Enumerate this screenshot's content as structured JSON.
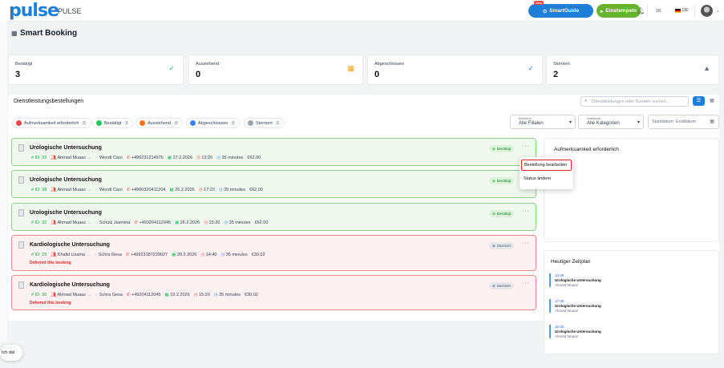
{
  "header": {
    "logo": "pulse",
    "brand": "PULSE",
    "new_badge": "New",
    "smartguide": "SmartGuide",
    "login": "Einstempeln",
    "lang": "DE"
  },
  "page": {
    "title": "Smart Booking"
  },
  "stats": [
    {
      "label": "Bestätigt",
      "value": "3",
      "icon": "✓",
      "color": "#22c55e"
    },
    {
      "label": "Ausstehend",
      "value": "0",
      "icon": "▦",
      "color": "#f59e0b"
    },
    {
      "label": "Abgeschlossen",
      "value": "0",
      "icon": "✓",
      "color": "#3b82f6"
    },
    {
      "label": "Storniert",
      "value": "2",
      "icon": "▲",
      "color": "#6b7280"
    }
  ],
  "section": {
    "title": "Dienstleistungsbestellungen",
    "search_placeholder": "Dienstleistungen oder Kunden suchen..."
  },
  "chips": [
    {
      "label": "Aufmerksamkeit erforderlich",
      "count": "0",
      "color": "#ef4444"
    },
    {
      "label": "Bestätigt",
      "count": "3",
      "color": "#22c55e"
    },
    {
      "label": "Ausstehend",
      "count": "0",
      "color": "#f97316"
    },
    {
      "label": "Abgeschlossen",
      "count": "0",
      "color": "#3b82f6"
    },
    {
      "label": "Storniert",
      "count": "2",
      "color": "#9ca3af"
    }
  ],
  "filters": {
    "branch_label": "Bereiche",
    "branch_value": "Alle Filialen",
    "category_label": "Kategorie",
    "category_value": "Alle Kategorien",
    "date_label": "Startdatum",
    "date_placeholder": "Enddatum"
  },
  "bookings": [
    {
      "title": "Urologische Untersuchung",
      "id": "ID: 33",
      "doctor": "Ahmad Muaaz",
      "patient": "Wendl Caro",
      "phone": "+496231214976",
      "date": "27.2.2026",
      "time": "13:20",
      "duration": "35 minutes",
      "price": "€62.00",
      "status": "Bestätigt",
      "note": ""
    },
    {
      "title": "Urologische Untersuchung",
      "id": "ID: 38",
      "doctor": "Ahmad Muaaz",
      "patient": "Wendl Caro",
      "phone": "+4960320411204",
      "date": "26.2.2026",
      "time": "17:20",
      "duration": "35 minutes",
      "price": "€62.00",
      "status": "Bestätigt",
      "note": ""
    },
    {
      "title": "Urologische Untersuchung",
      "id": "ID: 32",
      "doctor": "Ahmad Muaaz",
      "patient": "Schulz Jasmina",
      "phone": "+493204112045",
      "date": "26.2.2026",
      "time": "15:20",
      "duration": "35 minutes",
      "price": "€62.00",
      "status": "Bestätigt",
      "note": ""
    },
    {
      "title": "Kardiologische Untersuchung",
      "id": "ID: 29",
      "doctor": "Khalid Usama",
      "patient": "Schra Gesa",
      "phone": "+49923187229027",
      "date": "20.2.2026",
      "time": "14:40",
      "duration": "35 minutes",
      "price": "€30.02",
      "status": "Storniert",
      "note": "Deferred this booking"
    },
    {
      "title": "Kardiologische Untersuchung",
      "id": "ID: 30",
      "doctor": "Ahmad Muaaz",
      "patient": "Schra Gesa",
      "phone": "+49204112045",
      "date": "19.2.2026",
      "time": "15:20",
      "duration": "35 minutes",
      "price": "€30.02",
      "status": "Storniert",
      "note": "Deferred this booking"
    }
  ],
  "menu": {
    "edit": "Bestellung bearbeiten",
    "status": "Status ändern"
  },
  "attention": {
    "title": "Aufmerksamkeit erforderlich"
  },
  "schedule": {
    "title": "Heutiger Zeitplan",
    "items": [
      {
        "time": "13:30",
        "service": "Urologische Untersuchung",
        "person": "Ahmad Muaaz"
      },
      {
        "time": "17:30",
        "service": "Urologische Untersuchung",
        "person": "Ahmad Muaaz"
      },
      {
        "time": "15:30",
        "service": "Urologische Untersuchung",
        "person": "Ahmad Muaaz"
      }
    ]
  },
  "chat": {
    "label": "Ich da!"
  }
}
